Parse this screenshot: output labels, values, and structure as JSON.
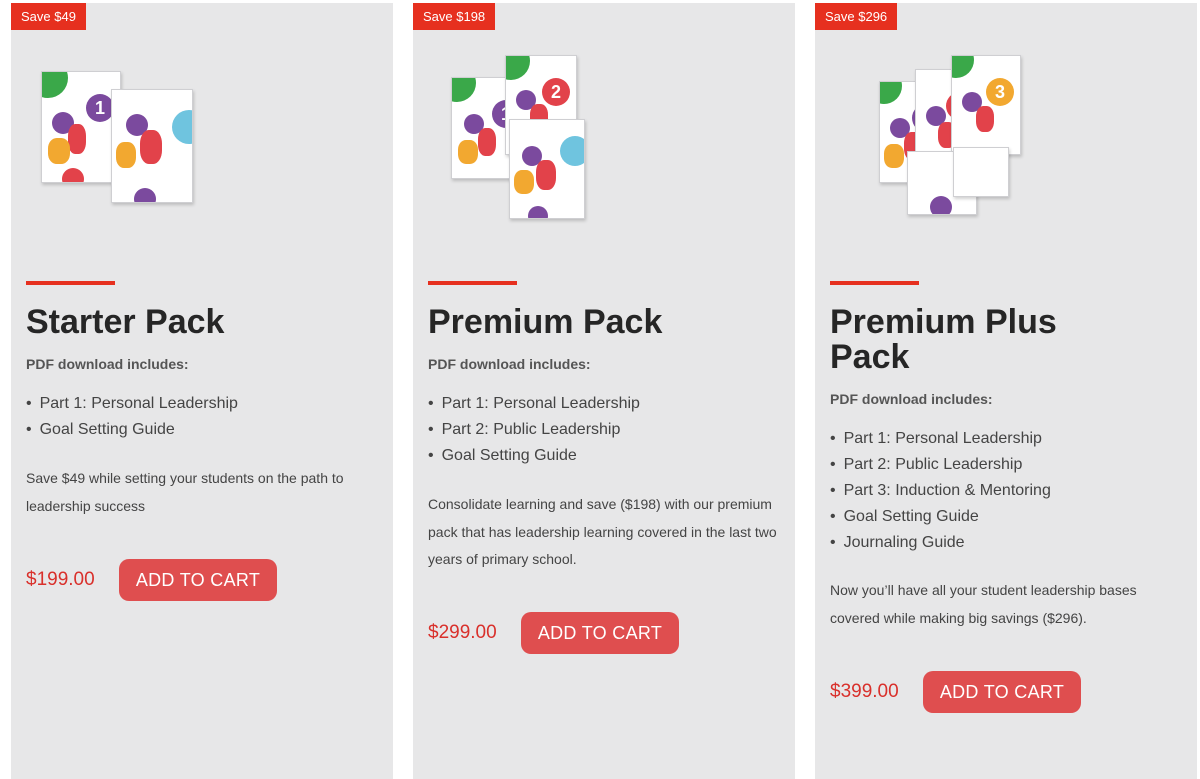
{
  "cards": [
    {
      "badge": "Save $49",
      "title": "Starter Pack",
      "includes_label": "PDF download includes:",
      "items": [
        "Part 1: Personal Leadership",
        "Goal Setting Guide"
      ],
      "description": "Save $49 while setting your students on the path to leadership success",
      "price": "$199.00",
      "cart_label": "ADD TO CART"
    },
    {
      "badge": "Save $198",
      "title": "Premium Pack",
      "includes_label": "PDF download includes:",
      "items": [
        "Part 1: Personal Leadership",
        "Part 2: Public Leadership",
        "Goal Setting Guide"
      ],
      "description": "Consolidate learning and save ($198) with our premium pack that has leadership learning covered in the last two years of primary school.",
      "price": "$299.00",
      "cart_label": "ADD TO CART"
    },
    {
      "badge": "Save $296",
      "title": "Premium Plus Pack",
      "includes_label": "PDF download includes:",
      "items": [
        "Part 1: Personal Leadership",
        "Part 2: Public Leadership",
        "Part 3: Induction & Mentoring",
        "Goal Setting Guide",
        "Journaling Guide"
      ],
      "description": "Now you’ll have all your student leadership bases covered while making big savings ($296).",
      "price": "$399.00",
      "cart_label": "ADD TO CART"
    }
  ],
  "colors": {
    "badge": "#e6301f",
    "accent": "#e6301f",
    "price": "#d9302b",
    "button": "#df4e4f",
    "card_bg": "#e7e7e8"
  }
}
